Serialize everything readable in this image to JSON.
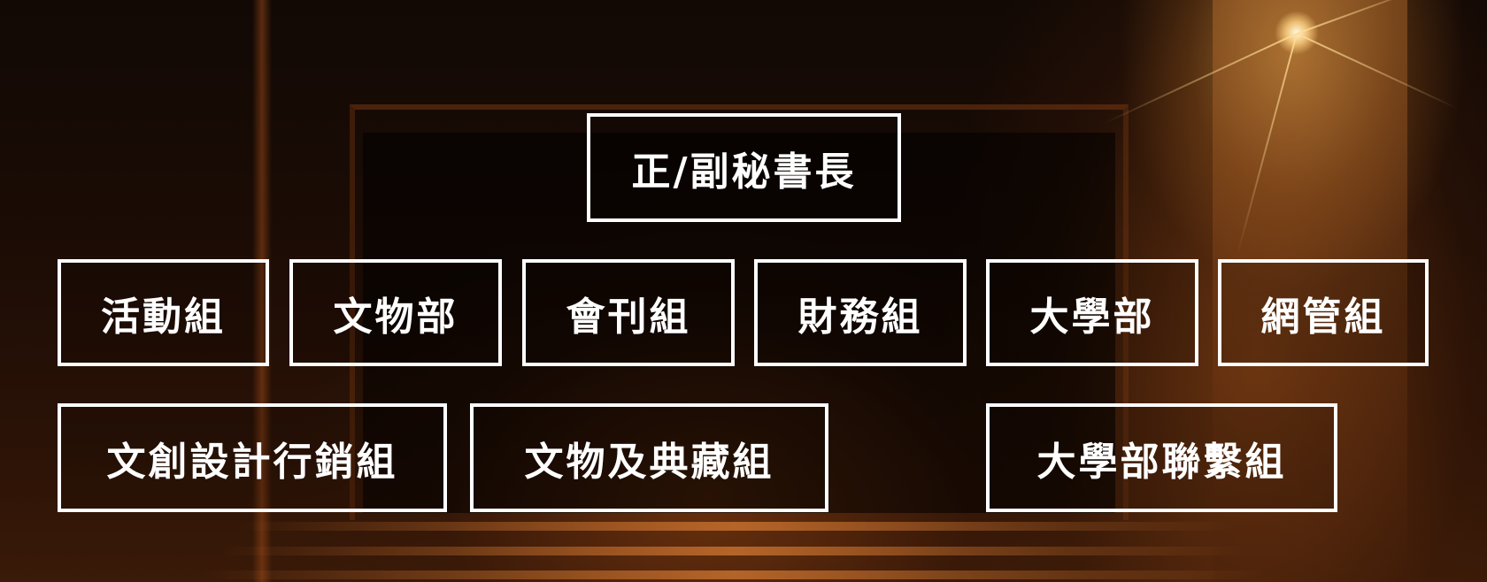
{
  "colors": {
    "box_border": "#ffffff",
    "box_text": "#ffffff",
    "background_dark": "#120905",
    "background_warm": "#3a1a08"
  },
  "diagram": {
    "top": {
      "label": "正/副秘書長"
    },
    "row1": [
      {
        "label": "活動組"
      },
      {
        "label": "文物部"
      },
      {
        "label": "會刊組"
      },
      {
        "label": "財務組"
      },
      {
        "label": "大學部"
      },
      {
        "label": "網管組"
      }
    ],
    "row2": [
      {
        "label": "文創設計行銷組"
      },
      {
        "label": "文物及典藏組"
      },
      {
        "label": "大學部聯繫組"
      }
    ]
  }
}
